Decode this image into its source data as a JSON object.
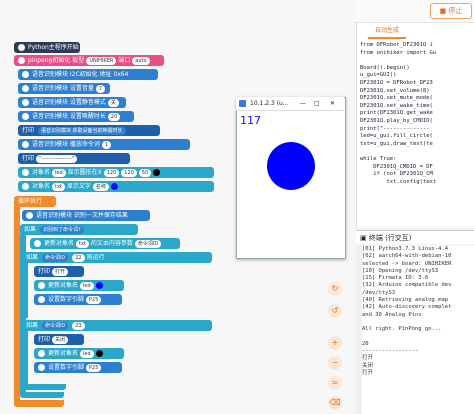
{
  "toolbar": {
    "stop_label": "停止"
  },
  "blocks": {
    "hat": "Python主程序开始",
    "init": "pinpong初始化",
    "init_board": "板型",
    "init_port": "端口",
    "init_board_val": "UNIHIKER",
    "init_port_val": "auto",
    "b1": "语音识别模块 I2C初始化 地址 0x64",
    "b2": "语音识别模块 设置音量",
    "b2_val": "7",
    "b3": "语音识别模块 设置静音模式",
    "b3_val": "关",
    "b4": "语音识别模块 设置唤醒时长",
    "b4_val": "20",
    "b5": "打印",
    "b5_val": "语音识别模块 获取设备当前唤醒时长",
    "b6": "语音识别模块 播放命令词",
    "b6_val": "1",
    "b7": "打印",
    "b7_val": "\"-----------------\"",
    "b8": "对象名",
    "b8_val": "led",
    "b8_rest": "显示圆形在X",
    "b8_x": "120",
    "b8_y": "120",
    "b8_r": "50",
    "b9": "对象名",
    "b9_val": "txt",
    "b9_rest": "显示文字",
    "b9_t": "名称",
    "b10": "循环执行",
    "b11": "语音识别模块 识别一次并保存结果",
    "b12": "如果",
    "b12_val": "识别到了命令词?",
    "b13": "更新对象名",
    "b13_val": "txt",
    "b13_rest": "的文本内容参数",
    "b13_t": "命令词ID",
    "b14": "如果",
    "b14_val": "命令词ID",
    "b14_eq": "22",
    "b14_rest": "则运行",
    "b15": "打印",
    "b15_val": "打开",
    "b16": "更新对象名",
    "b16_val": "led",
    "b17": "设置数字引脚",
    "b17_val": "P25",
    "b18": "如果",
    "b18_val": "命令词ID",
    "b18_eq": "23",
    "b19": "打印",
    "b19_val": "关闭",
    "b20": "更新对象名",
    "b20_val": "led",
    "b21": "设置数字引脚",
    "b21_val": "P25"
  },
  "code": {
    "tab": "自动生成",
    "lines": [
      "from DFRobot_DF2301Q i",
      "from unihiker import Gu",
      "",
      "Board().begin()",
      "u_gui=GUI()",
      "DF2301Q = DFRobot_DF23",
      "DF2301Q.set_volume(8)",
      "DF2301Q.set_mute_mode(",
      "DF2301Q.set_wake_time(",
      "print(DF2301Q.get_wake",
      "DF2301Q.play_by_CMDID(",
      "print(\"--------------",
      "led=u_gui.fill_circle(",
      "txt=u_gui.draw_text(te",
      "",
      "while True:",
      "    DF2301Q_CMDID = DF",
      "    if (not DF2301Q_CM",
      "        txt.config(text"
    ]
  },
  "terminal": {
    "title": "终端 (行交互)",
    "lines": [
      "[01] Python3.7.3 Linux-4.4",
      "[02] aarch64-with-debian-10",
      "selected -> board: UNIHIKER",
      "[10] Opening /dev/ttyS3",
      "[15] Firmata ID: 3.6",
      "[32] Arduino compatible dev",
      "/dev/ttyS3",
      "[40] Retrieving analog map",
      "[42] Auto-discovery complet",
      "and 30 Analog Pins",
      "",
      "All right. PinPong go...",
      "",
      "20",
      "-----------------",
      "打开",
      "关闭",
      "打开"
    ]
  },
  "window": {
    "title": "10.1.2.3 (u...",
    "value": "117",
    "circle_color": "#0000ff"
  }
}
